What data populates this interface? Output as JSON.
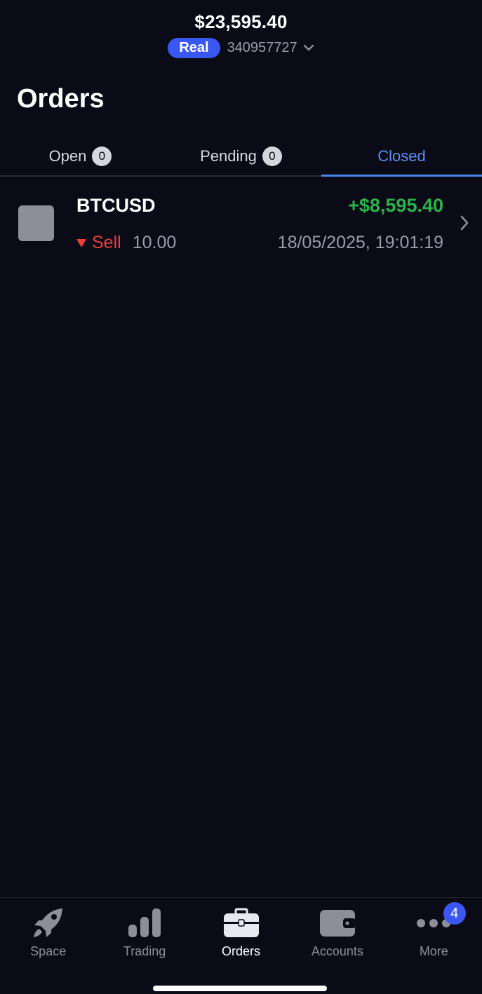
{
  "header": {
    "balance": "$23,595.40",
    "account_type": "Real",
    "account_number": "340957727"
  },
  "page": {
    "title": "Orders"
  },
  "tabs": [
    {
      "label": "Open",
      "count": "0",
      "active": false
    },
    {
      "label": "Pending",
      "count": "0",
      "active": false
    },
    {
      "label": "Closed",
      "active": true
    }
  ],
  "orders": [
    {
      "symbol": "BTCUSD",
      "profit": "+$8,595.40",
      "side": "Sell",
      "volume": "10.00",
      "closed_at": "18/05/2025, 19:01:19"
    }
  ],
  "bottom_nav": {
    "items": [
      {
        "label": "Space",
        "icon": "rocket-icon",
        "active": false
      },
      {
        "label": "Trading",
        "icon": "bar-chart-icon",
        "active": false
      },
      {
        "label": "Orders",
        "icon": "briefcase-icon",
        "active": true
      },
      {
        "label": "Accounts",
        "icon": "wallet-icon",
        "active": false
      },
      {
        "label": "More",
        "icon": "more-dots-icon",
        "active": false,
        "badge": "4"
      }
    ]
  },
  "colors": {
    "background": "#0b0b18",
    "accent": "#3b57f2",
    "active_tab": "#5b8ef0",
    "profit": "#2ab34a",
    "sell": "#ee3b3b",
    "muted": "#9a9bab"
  }
}
